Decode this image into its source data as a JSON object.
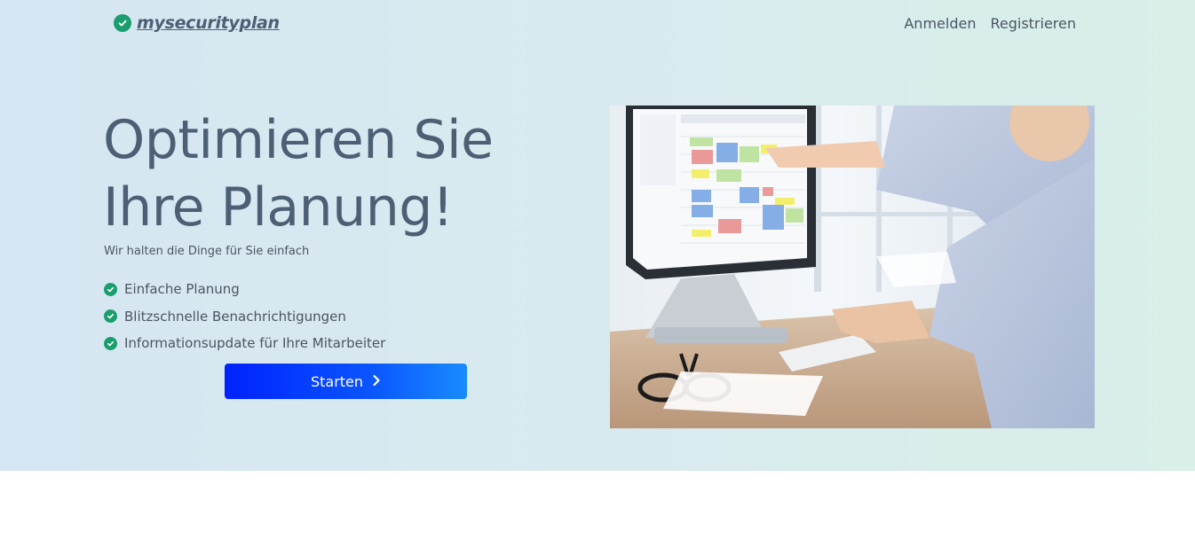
{
  "header": {
    "brand": "mysecurityplan",
    "nav": {
      "login": "Anmelden",
      "register": "Registrieren"
    }
  },
  "hero": {
    "headline": "Optimieren Sie Ihre Planung!",
    "subline": "Wir halten die Dinge für Sie einfach",
    "features": [
      "Einfache Planung",
      "Blitzschnelle Benachrichtigungen",
      "Informationsupdate für Ihre Mitarbeiter"
    ],
    "cta_label": "Starten"
  },
  "colors": {
    "accent_green": "#1a9e6e",
    "cta_blue": "#0022ff",
    "text_slate": "#4d5f74"
  },
  "icons": [
    "check-circle-icon",
    "chevron-right-icon"
  ]
}
